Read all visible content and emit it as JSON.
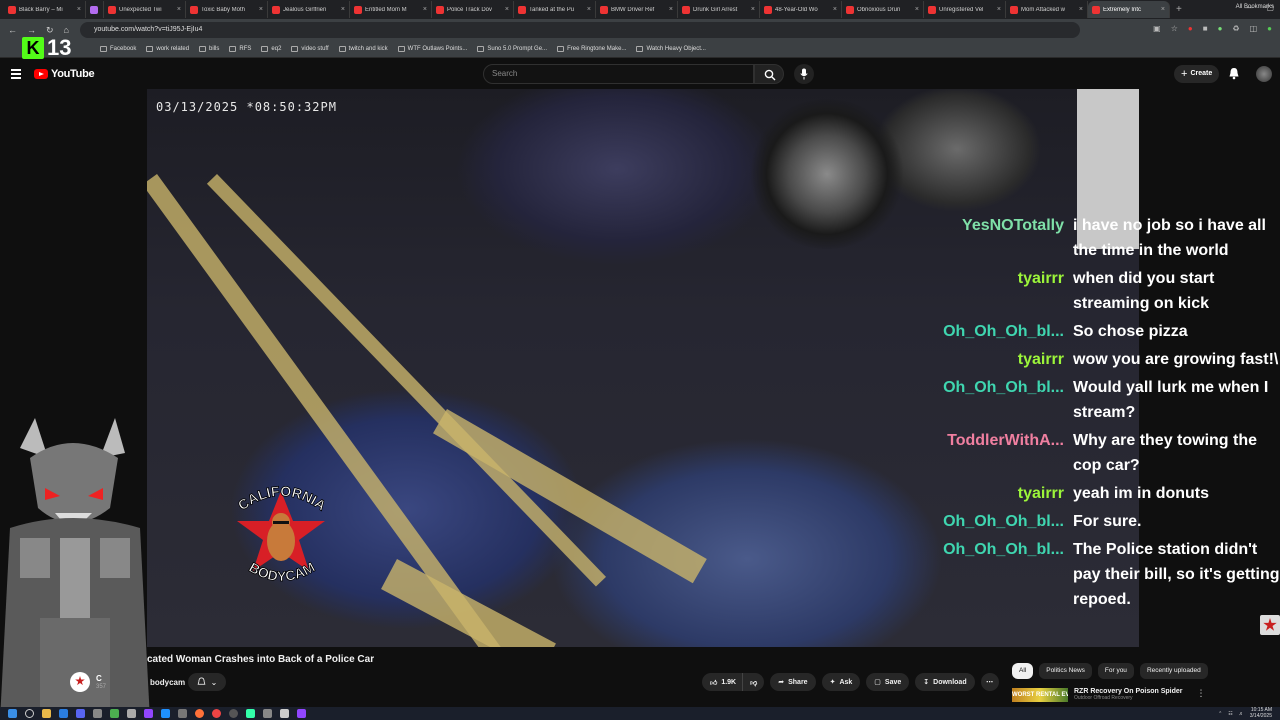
{
  "browser": {
    "tabs": [
      {
        "title": "Black Barry – Mi",
        "purple": false,
        "active": false
      },
      {
        "title": "",
        "purple": true,
        "active": false
      },
      {
        "title": "Unexpected Twi",
        "purple": false,
        "active": false
      },
      {
        "title": "Toxic Baby Moth",
        "purple": false,
        "active": false
      },
      {
        "title": "Jealous Girlfrien",
        "purple": false,
        "active": false
      },
      {
        "title": "Entitled Mom M",
        "purple": false,
        "active": false
      },
      {
        "title": "Police Track Dov",
        "purple": false,
        "active": false
      },
      {
        "title": "Tanked at the Pu",
        "purple": false,
        "active": false
      },
      {
        "title": "BMW Driver Ref",
        "purple": false,
        "active": false
      },
      {
        "title": "Drunk Girl Arrest",
        "purple": false,
        "active": false
      },
      {
        "title": "48-Year-Old Wo",
        "purple": false,
        "active": false
      },
      {
        "title": "Obnoxious Drun",
        "purple": false,
        "active": false
      },
      {
        "title": "Unregistered Vel",
        "purple": false,
        "active": false
      },
      {
        "title": "Mom Attacked w",
        "purple": false,
        "active": false
      },
      {
        "title": "Extremely Intc",
        "purple": false,
        "active": true
      }
    ],
    "url": "youtube.com/watch?v=tiJ95J-EjIu4",
    "bookmarks": [
      "Facebook",
      "work related",
      "bills",
      "RFS",
      "eq2",
      "video stuff",
      "twitch and kick",
      "WTF Outlaws Points...",
      "Suno 5.0 Prompt Ge...",
      "Free Ringtone Make...",
      "Watch Heavy Object..."
    ],
    "all_bookmarks": "All Bookmarks",
    "kick_count": "13"
  },
  "youtube": {
    "logo_text": "YouTube",
    "search_placeholder": "Search",
    "create_label": "Create"
  },
  "video": {
    "timestamp": "03/13/2025 *08:50:32PM",
    "watermark_top": "CALIFORNIA",
    "watermark_bottom": "BODYCAM"
  },
  "chat": [
    {
      "user": "YesNOTotally",
      "color": "#7fe0a8",
      "text": "i have no job so i have all the time in the world"
    },
    {
      "user": "tyairrr",
      "color": "#9cf53a",
      "text": "when did you start streaming on kick"
    },
    {
      "user": "Oh_Oh_Oh_bl...",
      "color": "#3fd6b0",
      "text": "So chose pizza"
    },
    {
      "user": "tyairrr",
      "color": "#9cf53a",
      "text": "wow you are growing fast!\\"
    },
    {
      "user": "Oh_Oh_Oh_bl...",
      "color": "#3fd6b0",
      "text": "Would yall lurk me when I stream?"
    },
    {
      "user": "ToddlerWithA...",
      "color": "#f07fa0",
      "text": "Why are they towing the cop car?"
    },
    {
      "user": "tyairrr",
      "color": "#9cf53a",
      "text": "yeah im in donuts"
    },
    {
      "user": "Oh_Oh_Oh_bl...",
      "color": "#3fd6b0",
      "text": "For sure."
    },
    {
      "user": "Oh_Oh_Oh_bl...",
      "color": "#3fd6b0",
      "text": "The Police station didn't pay their bill, so it's getting repoed."
    }
  ],
  "info": {
    "title": "cated Woman Crashes into Back of a Police Car",
    "channel_initial": "C",
    "channel_suffix": "bodycam",
    "subs": "357",
    "likes": "1.9K",
    "share": "Share",
    "ask": "Ask",
    "save": "Save",
    "download": "Download"
  },
  "chips": [
    {
      "label": "All",
      "active": true
    },
    {
      "label": "Politics News",
      "active": false
    },
    {
      "label": "For you",
      "active": false
    },
    {
      "label": "Recently uploaded",
      "active": false
    }
  ],
  "recommended": {
    "thumb_text": "WORST RENTAL EVER",
    "title": "RZR Recovery On Poison Spider",
    "sub": "Outdoor Offroad Recovery"
  },
  "taskbar": {
    "time": "10:15 AM",
    "date": "3/14/2025"
  }
}
